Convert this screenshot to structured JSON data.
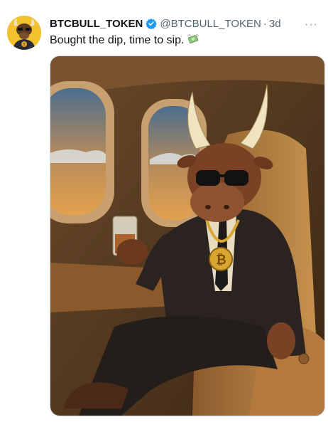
{
  "tweet": {
    "display_name": "BTCBULL_TOKEN",
    "handle": "@BTCBULL_TOKEN",
    "separator": "·",
    "time": "3d",
    "more": "···",
    "text": "Bought the dip, time to sip.",
    "emoji_icon": "money-with-wings-icon"
  },
  "colors": {
    "verified": "#1d9bf0",
    "avatar_bg": "#f2c12e",
    "text": "#0f1419",
    "muted": "#536471"
  }
}
